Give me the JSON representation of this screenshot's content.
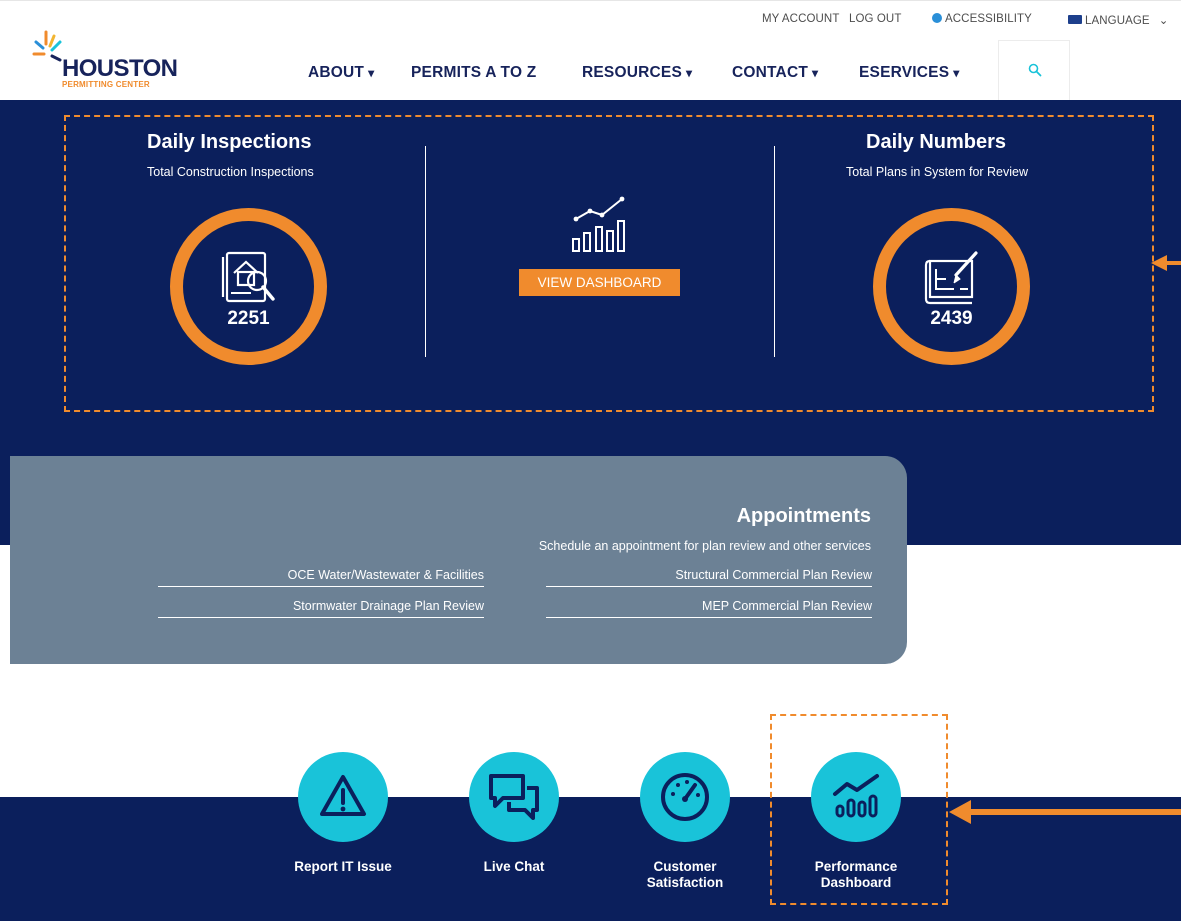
{
  "top_links": {
    "my_account": "MY ACCOUNT",
    "log_out": "LOG OUT",
    "accessibility": "ACCESSIBILITY",
    "language": "LANGUAGE"
  },
  "logo": {
    "word": "HOUSTON",
    "sub": "PERMITTING CENTER"
  },
  "nav": {
    "about": "ABOUT",
    "permits": "PERMITS A TO Z",
    "resources": "RESOURCES",
    "contact": "CONTACT",
    "eservices": "ESERVICES",
    "caret": "▾"
  },
  "dashboard": {
    "inspections": {
      "title": "Daily Inspections",
      "subtitle": "Total Construction Inspections",
      "value": "2251"
    },
    "numbers": {
      "title": "Daily Numbers",
      "subtitle": "Total Plans in System for Review",
      "value": "2439"
    },
    "view_button": "VIEW DASHBOARD"
  },
  "appointments": {
    "title": "Appointments",
    "subtitle": "Schedule an appointment for plan review and other services",
    "links": [
      "OCE Water/Wastewater & Facilities",
      "Structural Commercial Plan Review",
      "Stormwater Drainage Plan Review",
      "MEP Commercial Plan Review"
    ]
  },
  "quick_links": [
    {
      "label1": "Report IT Issue",
      "label2": "",
      "icon": "warning-icon"
    },
    {
      "label1": "Live Chat",
      "label2": "",
      "icon": "chat-icon"
    },
    {
      "label1": "Customer",
      "label2": "Satisfaction",
      "icon": "gauge-icon"
    },
    {
      "label1": "Performance",
      "label2": "Dashboard",
      "icon": "chart-icon"
    }
  ],
  "colors": {
    "navy": "#0b1f5c",
    "orange": "#f08b2d",
    "slate": "#6c8195",
    "cyan": "#19c3d9"
  }
}
